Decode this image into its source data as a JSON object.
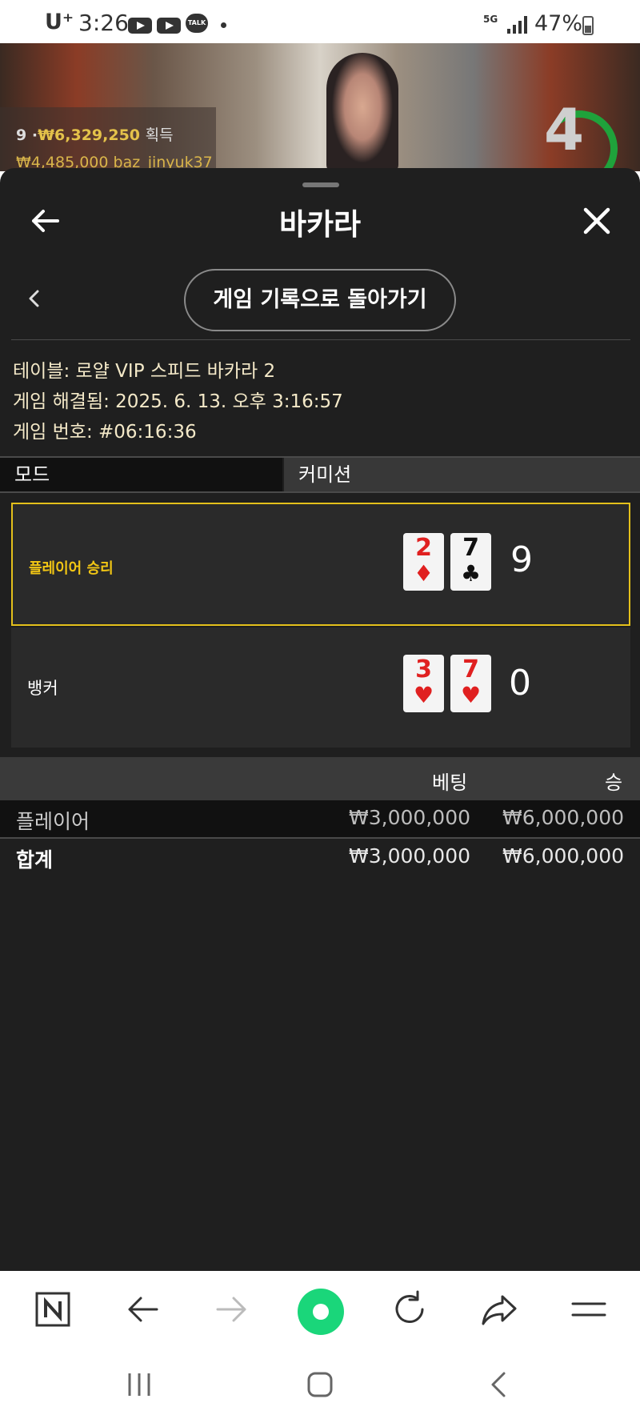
{
  "status_bar": {
    "carrier": "U⁺",
    "time": "3:26",
    "notification_icons": [
      "youtube-icon",
      "youtube-icon",
      "kakaotalk-icon"
    ],
    "talk_label": "TALK",
    "network": "5G",
    "battery": "47%"
  },
  "video": {
    "player_count": "9",
    "winnings_amount": "₩6,329,250",
    "winnings_label": "획득",
    "ticker_line": "₩4,485,000  baz_jinyuk37",
    "countdown": "4"
  },
  "sheet": {
    "title": "바카라",
    "back_history_label": "게임 기록으로 돌아가기",
    "info": {
      "table": "테이블: 로얄 VIP 스피드 바카라 2",
      "resolved": "게임 해결됨: 2025. 6. 13. 오후 3:16:57",
      "game_number": "게임 번호: #06:16:36"
    },
    "mode": {
      "label": "모드",
      "value": "커미션"
    },
    "results": {
      "player": {
        "label": "플레이어 승리",
        "cards": [
          {
            "rank": "2",
            "suit": "♦",
            "color": "red"
          },
          {
            "rank": "7",
            "suit": "♣",
            "color": "black"
          }
        ],
        "score": "9"
      },
      "banker": {
        "label": "뱅커",
        "cards": [
          {
            "rank": "3",
            "suit": "♥",
            "color": "red"
          },
          {
            "rank": "7",
            "suit": "♥",
            "color": "red"
          }
        ],
        "score": "0"
      }
    },
    "bets": {
      "headers": {
        "bet": "베팅",
        "win": "승"
      },
      "rows": [
        {
          "name": "플레이어",
          "bet": "₩3,000,000",
          "win": "₩6,000,000"
        }
      ],
      "total": {
        "name": "합계",
        "bet": "₩3,000,000",
        "win": "₩6,000,000"
      }
    }
  },
  "browser_toolbar": {
    "items": [
      "naver-icon",
      "back-icon",
      "forward-icon",
      "home-icon",
      "refresh-icon",
      "share-icon",
      "menu-icon"
    ]
  },
  "colors": {
    "accent_gold": "#f2c614",
    "sheet_bg": "#1f1f1f",
    "home_green": "#1ad67a"
  }
}
